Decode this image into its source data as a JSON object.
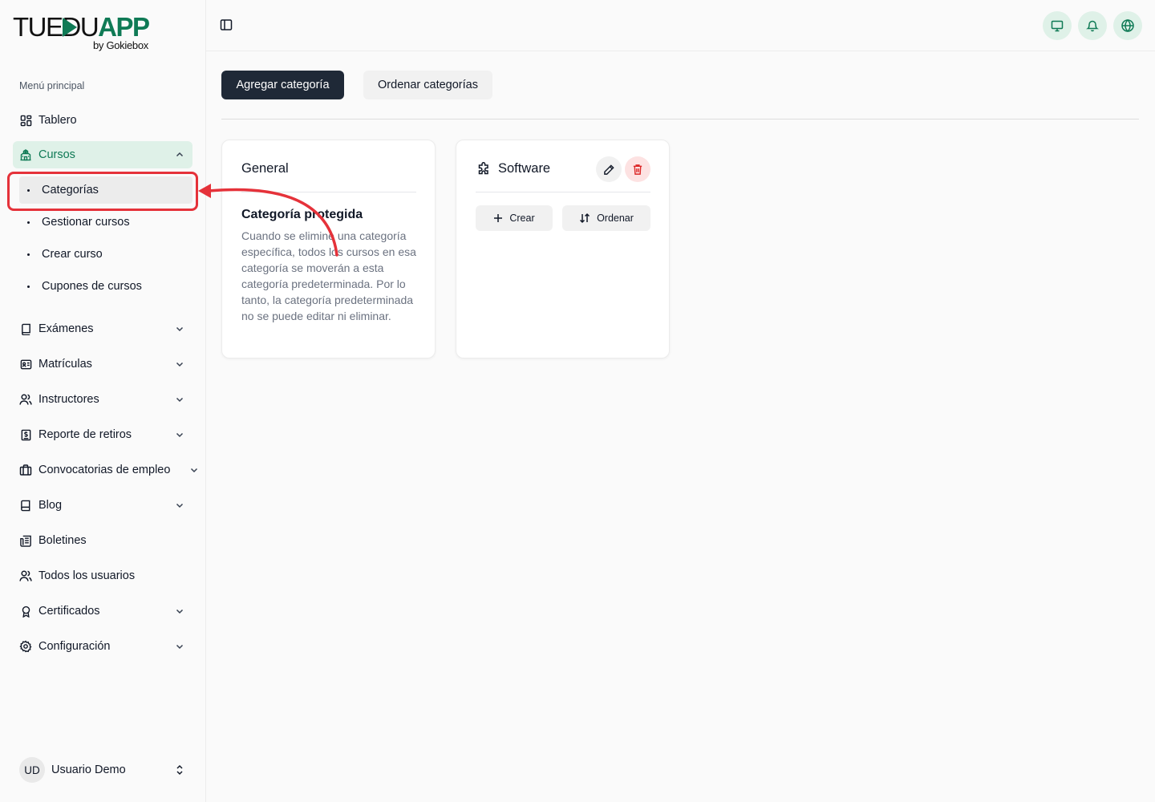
{
  "brand": {
    "word_a": "TUEDU",
    "word_b": "APP",
    "sub": "by Gokiebox",
    "accent": "#0f7a55"
  },
  "sidebar": {
    "section_title": "Menú principal",
    "items": [
      {
        "label": "Tablero",
        "icon": "dashboard-icon",
        "has_chevron": false
      },
      {
        "label": "Cursos",
        "icon": "school-icon",
        "has_chevron": true,
        "expanded": true,
        "active": true
      },
      {
        "label": "Exámenes",
        "icon": "book-icon",
        "has_chevron": true
      },
      {
        "label": "Matrículas",
        "icon": "id-card-icon",
        "has_chevron": true
      },
      {
        "label": "Instructores",
        "icon": "users-icon",
        "has_chevron": true
      },
      {
        "label": "Reporte de retiros",
        "icon": "receipt-icon",
        "has_chevron": true
      },
      {
        "label": "Convocatorias de empleo",
        "icon": "briefcase-icon",
        "has_chevron": true
      },
      {
        "label": "Blog",
        "icon": "notebook-icon",
        "has_chevron": true
      },
      {
        "label": "Boletines",
        "icon": "newspaper-icon",
        "has_chevron": false
      },
      {
        "label": "Todos los usuarios",
        "icon": "users-icon",
        "has_chevron": false
      },
      {
        "label": "Certificados",
        "icon": "award-icon",
        "has_chevron": true
      },
      {
        "label": "Configuración",
        "icon": "gear-icon",
        "has_chevron": true
      }
    ],
    "sub_items": [
      {
        "label": "Categorías",
        "selected": true
      },
      {
        "label": "Gestionar cursos"
      },
      {
        "label": "Crear curso"
      },
      {
        "label": "Cupones de cursos"
      }
    ],
    "user": {
      "initials": "UD",
      "name": "Usuario Demo"
    }
  },
  "topbar": {
    "icons": [
      "monitor-icon",
      "bell-icon",
      "globe-icon"
    ]
  },
  "toolbar": {
    "add_label": "Agregar categoría",
    "sort_label": "Ordenar categorías"
  },
  "cards": [
    {
      "title": "General",
      "protected_title": "Categoría protegida",
      "protected_text": "Cuando se elimine una categoría específica, todos los cursos en esa categoría se moverán a esta categoría predeterminada. Por lo tanto, la categoría predeterminada no se puede editar ni eliminar."
    },
    {
      "title": "Software",
      "icon": "puzzle-icon",
      "create_label": "Crear",
      "order_label": "Ordenar"
    }
  ],
  "colors": {
    "annotation_red": "#e5323a",
    "active_bg": "#dff1e8",
    "danger_bg": "#fde2e2",
    "danger": "#dc2626"
  }
}
